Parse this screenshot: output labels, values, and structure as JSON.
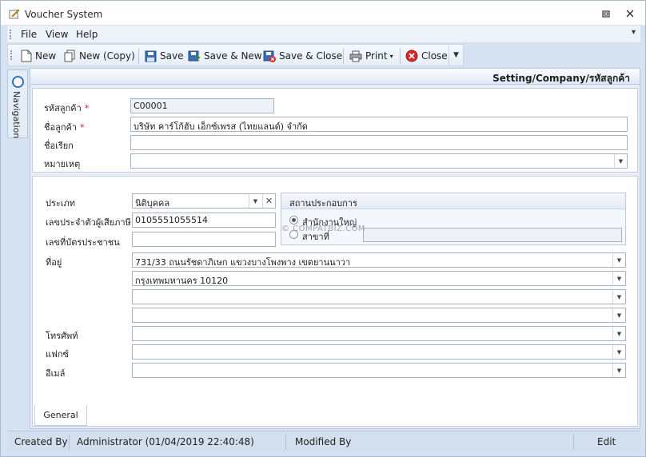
{
  "window": {
    "title": "Voucher System"
  },
  "menu": [
    "File",
    "View",
    "Help"
  ],
  "toolbar": {
    "new": "New",
    "new_copy": "New (Copy)",
    "save": "Save",
    "save_new": "Save & New",
    "save_close": "Save & Close",
    "print": "Print",
    "close": "Close"
  },
  "navigation": {
    "label": "Navigation"
  },
  "breadcrumb": "Setting/Company/รหัสลูกค้า",
  "customer": {
    "code_label": "รหัสลูกค้า",
    "code_value": "C00001",
    "name_label": "ชื่อลูกค้า",
    "name_value": "บริษัท คาร์โก้ฮับ เอ็กซ์เพรส (ไทยแลนด์) จำกัด",
    "alias_label": "ชื่อเรียก",
    "alias_value": "",
    "note_label": "หมายเหตุ",
    "note_value": "",
    "required_mark": "*"
  },
  "general": {
    "type_label": "ประเภท",
    "type_value": "นิติบุคคล",
    "taxid_label": "เลขประจำตัวผู้เสียภาษี",
    "taxid_value": "0105551055514",
    "idcard_label": "เลขที่บัตรประชาชน",
    "idcard_value": "",
    "address_label": "ที่อยู่",
    "address_lines": [
      "731/33 ถนนรัชดาภิเษก แขวงบางโพงพาง เขตยานนาวา",
      "กรุงเทพมหานคร 10120",
      "",
      ""
    ],
    "phone_label": "โทรศัพท์",
    "phone_value": "",
    "fax_label": "แฟกซ์",
    "fax_value": "",
    "email_label": "อีเมล์",
    "email_value": "",
    "establishment": {
      "title": "สถานประกอบการ",
      "head_office": "สำนักงานใหญ่",
      "branch": "สาขาที่",
      "branch_value": "",
      "selected": "head_office"
    }
  },
  "watermark": "© COMPATBIZ.COM",
  "tabs": [
    "General"
  ],
  "status": {
    "created_by_label": "Created By",
    "created_by_value": "Administrator (01/04/2019 22:40:48)",
    "modified_by_label": "Modified By",
    "mode": "Edit"
  }
}
